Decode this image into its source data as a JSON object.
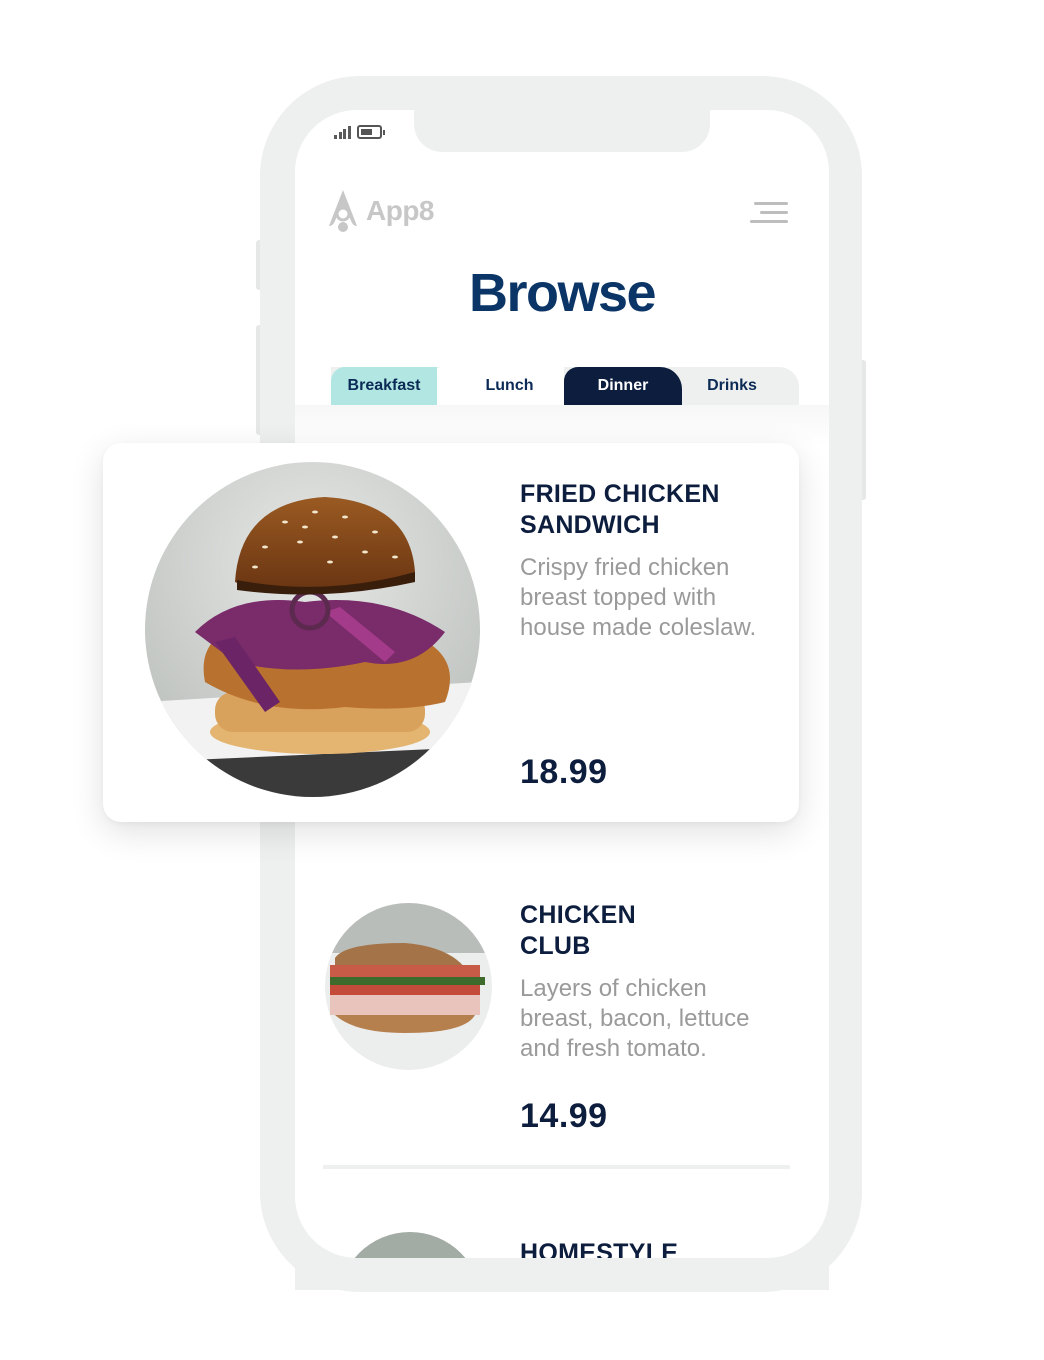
{
  "status_bar": {
    "signal_icon": "signal-bars-icon",
    "battery_icon": "battery-icon",
    "battery_level": 0.5
  },
  "header": {
    "logo_text": "App8",
    "logo_icon": "rocket-logo-icon",
    "menu_icon": "hamburger-menu-icon"
  },
  "page": {
    "title": "Browse"
  },
  "tabs": [
    {
      "label": "Breakfast",
      "color": "#b1e6e3"
    },
    {
      "label": "Lunch",
      "color": "#ffffff"
    },
    {
      "label": "Dinner",
      "color": "#0c1d3d",
      "active": true
    },
    {
      "label": "Drinks",
      "color": "#eef0ef"
    }
  ],
  "menu_items": [
    {
      "name_line1": "FRIED CHICKEN",
      "name_line2": "SANDWICH",
      "desc_line1": "Crispy fried chicken",
      "desc_line2": "breast topped with",
      "desc_line3": "house made coleslaw.",
      "price": "18.99",
      "image": "fried-chicken-sandwich-photo"
    },
    {
      "name_line1": "CHICKEN",
      "name_line2": "CLUB",
      "desc_line1": "Layers of chicken",
      "desc_line2": "breast, bacon, lettuce",
      "desc_line3": "and fresh tomato.",
      "price": "14.99",
      "image": "chicken-club-photo"
    },
    {
      "name_line1": "HOMESTYLE",
      "image": "homestyle-photo"
    }
  ],
  "colors": {
    "brand_navy": "#0a3566",
    "dark_navy": "#0c1d3d",
    "mint": "#b1e6e3",
    "frame_gray": "#eef0ef",
    "desc_gray": "#9a9a9a"
  }
}
